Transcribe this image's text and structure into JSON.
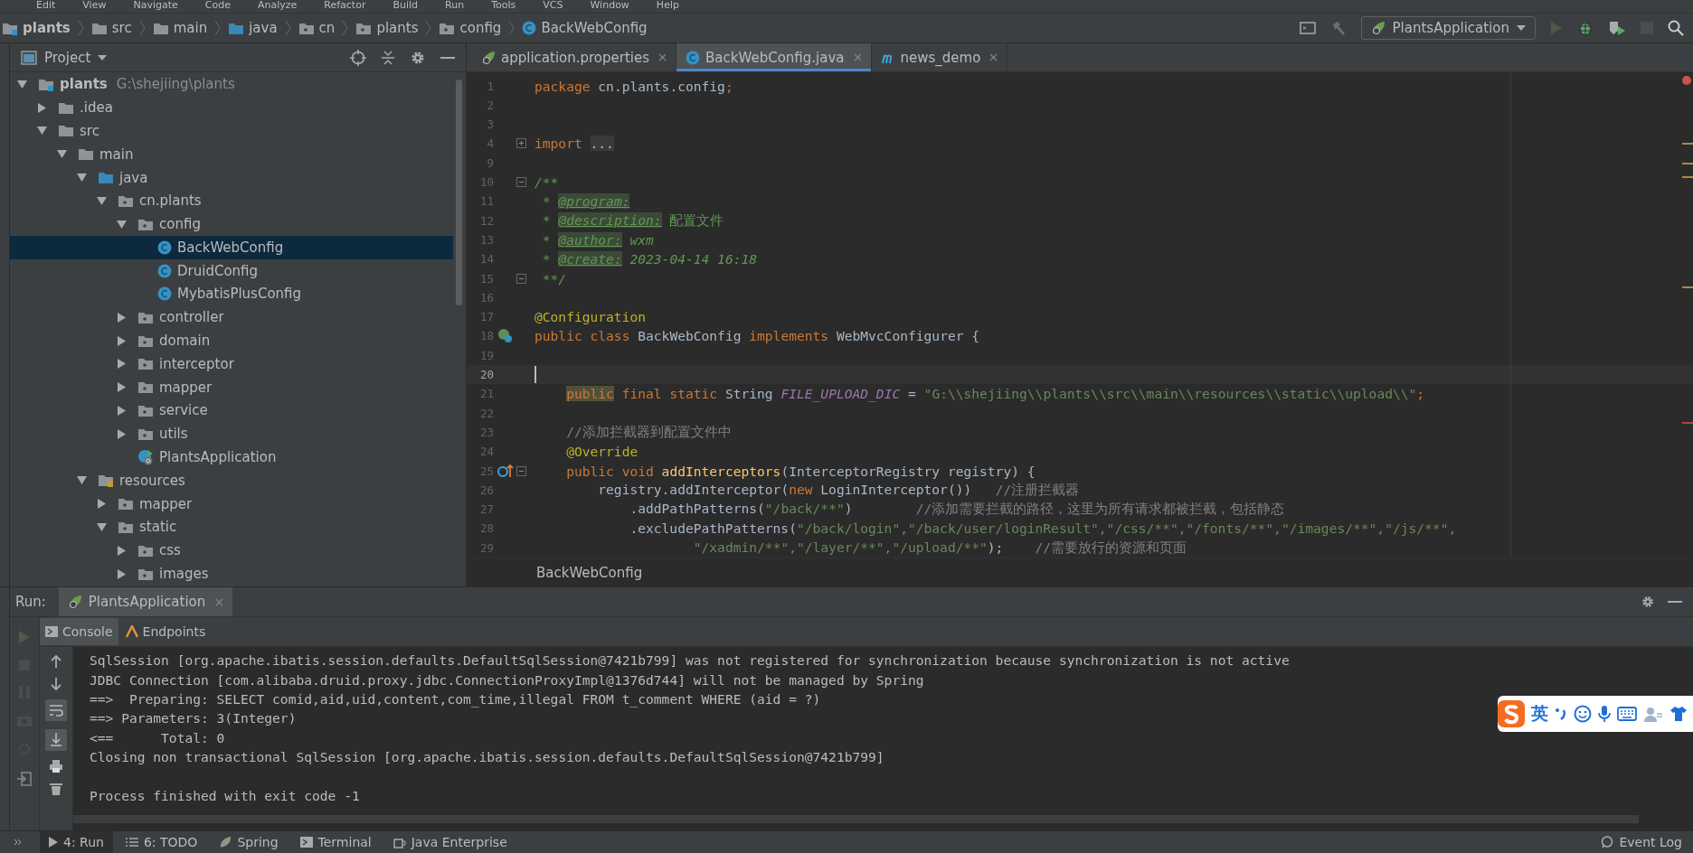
{
  "menu": [
    "Edit",
    "View",
    "Navigate",
    "Code",
    "Analyze",
    "Refactor",
    "Build",
    "Run",
    "Tools",
    "VCS",
    "Window",
    "Help"
  ],
  "breadcrumb": [
    {
      "label": "plants",
      "kind": "module"
    },
    {
      "label": "src",
      "kind": "folder"
    },
    {
      "label": "main",
      "kind": "folder"
    },
    {
      "label": "java",
      "kind": "source-root"
    },
    {
      "label": "cn",
      "kind": "package"
    },
    {
      "label": "plants",
      "kind": "package"
    },
    {
      "label": "config",
      "kind": "package"
    },
    {
      "label": "BackWebConfig",
      "kind": "class"
    }
  ],
  "run_config": "PlantsApplication",
  "project": {
    "title": "Project",
    "tree": [
      {
        "label": "plants",
        "path": "G:\\shejiing\\plants",
        "kind": "module",
        "expanded": true,
        "selected": false,
        "children": [
          {
            "label": ".idea",
            "kind": "folder",
            "expanded": false,
            "selected": false
          },
          {
            "label": "src",
            "kind": "folder",
            "expanded": true,
            "selected": false,
            "children": [
              {
                "label": "main",
                "kind": "folder",
                "expanded": true,
                "selected": false,
                "children": [
                  {
                    "label": "java",
                    "kind": "source-root",
                    "expanded": true,
                    "selected": false,
                    "children": [
                      {
                        "label": "cn.plants",
                        "kind": "package",
                        "expanded": true,
                        "selected": false,
                        "children": [
                          {
                            "label": "config",
                            "kind": "package",
                            "expanded": true,
                            "selected": false,
                            "children": [
                              {
                                "label": "BackWebConfig",
                                "kind": "class",
                                "selected": true
                              },
                              {
                                "label": "DruidConfig",
                                "kind": "class",
                                "selected": false
                              },
                              {
                                "label": "MybatisPlusConfig",
                                "kind": "class",
                                "selected": false
                              }
                            ]
                          },
                          {
                            "label": "controller",
                            "kind": "package",
                            "expanded": false,
                            "selected": false
                          },
                          {
                            "label": "domain",
                            "kind": "package",
                            "expanded": false,
                            "selected": false
                          },
                          {
                            "label": "interceptor",
                            "kind": "package",
                            "expanded": false,
                            "selected": false
                          },
                          {
                            "label": "mapper",
                            "kind": "package",
                            "expanded": false,
                            "selected": false
                          },
                          {
                            "label": "service",
                            "kind": "package",
                            "expanded": false,
                            "selected": false
                          },
                          {
                            "label": "utils",
                            "kind": "package",
                            "expanded": false,
                            "selected": false
                          },
                          {
                            "label": "PlantsApplication",
                            "kind": "app",
                            "selected": false
                          }
                        ]
                      }
                    ]
                  },
                  {
                    "label": "resources",
                    "kind": "resources",
                    "expanded": true,
                    "selected": false,
                    "children": [
                      {
                        "label": "mapper",
                        "kind": "package",
                        "expanded": false,
                        "selected": false
                      },
                      {
                        "label": "static",
                        "kind": "package",
                        "expanded": true,
                        "selected": false,
                        "children": [
                          {
                            "label": "css",
                            "kind": "package",
                            "expanded": false,
                            "selected": false
                          },
                          {
                            "label": "images",
                            "kind": "package",
                            "expanded": false,
                            "selected": false
                          }
                        ]
                      }
                    ]
                  }
                ]
              }
            ]
          }
        ]
      }
    ]
  },
  "editor": {
    "tabs": [
      {
        "label": "application.properties",
        "kind": "spring",
        "selected": false
      },
      {
        "label": "BackWebConfig.java",
        "kind": "class",
        "selected": true
      },
      {
        "label": "news_demo",
        "kind": "module",
        "selected": false
      }
    ],
    "lines": [
      {
        "number": "1",
        "current": false,
        "tokens": [
          {
            "kind": "kw",
            "text": "package"
          },
          {
            "kind": "plain",
            "text": " cn.plants.config"
          },
          {
            "kind": "kw",
            "text": ";"
          }
        ]
      },
      {
        "number": "2",
        "current": false
      },
      {
        "number": "3",
        "current": false
      },
      {
        "number": "4",
        "current": false,
        "tokens": [
          {
            "kind": "kw",
            "text": "import "
          },
          {
            "kind": "fold",
            "text": "..."
          }
        ]
      },
      {
        "number": "9",
        "current": false
      },
      {
        "number": "10",
        "current": false,
        "tokens": [
          {
            "kind": "doc",
            "text": "/**"
          }
        ]
      },
      {
        "number": "11",
        "current": false,
        "tokens": [
          {
            "kind": "doc",
            "text": " * "
          },
          {
            "kind": "doctag",
            "text": "@program:"
          }
        ]
      },
      {
        "number": "12",
        "current": false,
        "tokens": [
          {
            "kind": "doc",
            "text": " * "
          },
          {
            "kind": "doctag",
            "text": "@description:"
          },
          {
            "kind": "doctext",
            "text": " 配置文件"
          }
        ]
      },
      {
        "number": "13",
        "current": false,
        "tokens": [
          {
            "kind": "doc",
            "text": " * "
          },
          {
            "kind": "doctag",
            "text": "@author:"
          },
          {
            "kind": "doc",
            "text": " wxm"
          }
        ]
      },
      {
        "number": "14",
        "current": false,
        "tokens": [
          {
            "kind": "doc",
            "text": " * "
          },
          {
            "kind": "doctag",
            "text": "@create:"
          },
          {
            "kind": "doc",
            "text": " 2023-04-14 16:18"
          }
        ]
      },
      {
        "number": "15",
        "current": false,
        "tokens": [
          {
            "kind": "doc",
            "text": " **/"
          }
        ]
      },
      {
        "number": "16",
        "current": false
      },
      {
        "number": "17",
        "current": false,
        "tokens": [
          {
            "kind": "annotation",
            "text": "@Configuration"
          }
        ]
      },
      {
        "number": "18",
        "current": false,
        "tokens": [
          {
            "kind": "kw",
            "text": "public class "
          },
          {
            "kind": "plain",
            "text": "BackWebConfig "
          },
          {
            "kind": "kw",
            "text": "implements "
          },
          {
            "kind": "plain",
            "text": "WebMvcConfigurer {"
          }
        ]
      },
      {
        "number": "19",
        "current": false
      },
      {
        "number": "20",
        "current": true
      },
      {
        "number": "21",
        "current": false,
        "tokens": [
          {
            "kind": "kwmark",
            "text": "    public"
          },
          {
            "kind": "kw",
            "text": " final static "
          },
          {
            "kind": "plain",
            "text": "String "
          },
          {
            "kind": "constant",
            "text": "FILE_UPLOAD_DIC"
          },
          {
            "kind": "plain",
            "text": " = "
          },
          {
            "kind": "string",
            "text": "\"G:\\\\shejiing\\\\plants\\\\src\\\\main\\\\resources\\\\static\\\\upload\\\\\""
          },
          {
            "kind": "kw",
            "text": ";"
          }
        ]
      },
      {
        "number": "22",
        "current": false
      },
      {
        "number": "23",
        "current": false,
        "tokens": [
          {
            "kind": "comment",
            "text": "    //添加拦截器到配置文件中"
          }
        ]
      },
      {
        "number": "24",
        "current": false,
        "tokens": [
          {
            "kind": "annotation",
            "text": "    @Override"
          }
        ]
      },
      {
        "number": "25",
        "current": false,
        "tokens": [
          {
            "kind": "kw",
            "text": "    public void "
          },
          {
            "kind": "method",
            "text": "addInterceptors"
          },
          {
            "kind": "plain",
            "text": "(InterceptorRegistry registry) {"
          }
        ]
      },
      {
        "number": "26",
        "current": false,
        "tokens": [
          {
            "kind": "plain",
            "text": "        registry.addInterceptor("
          },
          {
            "kind": "kw",
            "text": "new "
          },
          {
            "kind": "plain",
            "text": "LoginInterceptor())   "
          },
          {
            "kind": "comment",
            "text": "//注册拦截器"
          }
        ]
      },
      {
        "number": "27",
        "current": false,
        "tokens": [
          {
            "kind": "plain",
            "text": "            .addPathPatterns("
          },
          {
            "kind": "string",
            "text": "\"/back/**\""
          },
          {
            "kind": "plain",
            "text": ")        "
          },
          {
            "kind": "comment",
            "text": "//添加需要拦截的路径，这里为所有请求都被拦截，包括静态"
          }
        ]
      },
      {
        "number": "28",
        "current": false,
        "tokens": [
          {
            "kind": "plain",
            "text": "            .excludePathPatterns("
          },
          {
            "kind": "string",
            "text": "\"/back/login\",\"/back/user/loginResult\",\"/css/**\",\"/fonts/**\",\"/images/**\",\"/js/**\","
          }
        ]
      },
      {
        "number": "29",
        "current": false,
        "tokens": [
          {
            "kind": "string",
            "text": "                    \"/xadmin/**\",\"/layer/**\",\"/upload/**\""
          },
          {
            "kind": "plain",
            "text": ");    "
          },
          {
            "kind": "comment",
            "text": "//需要放行的资源和页面"
          }
        ]
      }
    ],
    "footer": "BackWebConfig"
  },
  "run": {
    "label": "Run:",
    "tab": "PlantsApplication",
    "subtabs": [
      {
        "label": "Console",
        "kind": "console",
        "selected": true
      },
      {
        "label": "Endpoints",
        "kind": "endpoints",
        "selected": false
      }
    ],
    "console": [
      "SqlSession [org.apache.ibatis.session.defaults.DefaultSqlSession@7421b799] was not registered for synchronization because synchronization is not active",
      "JDBC Connection [com.alibaba.druid.proxy.jdbc.ConnectionProxyImpl@1376d744] will not be managed by Spring",
      "==>  Preparing: SELECT comid,aid,uid,content,com_time,illegal FROM t_comment WHERE (aid = ?)",
      "==> Parameters: 3(Integer)",
      "<==      Total: 0",
      "Closing non transactional SqlSession [org.apache.ibatis.session.defaults.DefaultSqlSession@7421b799]"
    ],
    "exit_message": "Process finished with exit code -1"
  },
  "ime": {
    "mode": "英"
  },
  "bottom_tools": [
    {
      "label": "4: Run",
      "kind": "run",
      "selected": true
    },
    {
      "label": "6: TODO",
      "kind": "todo",
      "selected": false
    },
    {
      "label": "Spring",
      "kind": "spring",
      "selected": false
    },
    {
      "label": "Terminal",
      "kind": "terminal",
      "selected": false
    },
    {
      "label": "Java Enterprise",
      "kind": "enterprise",
      "selected": false
    }
  ],
  "event_log": "Event Log"
}
